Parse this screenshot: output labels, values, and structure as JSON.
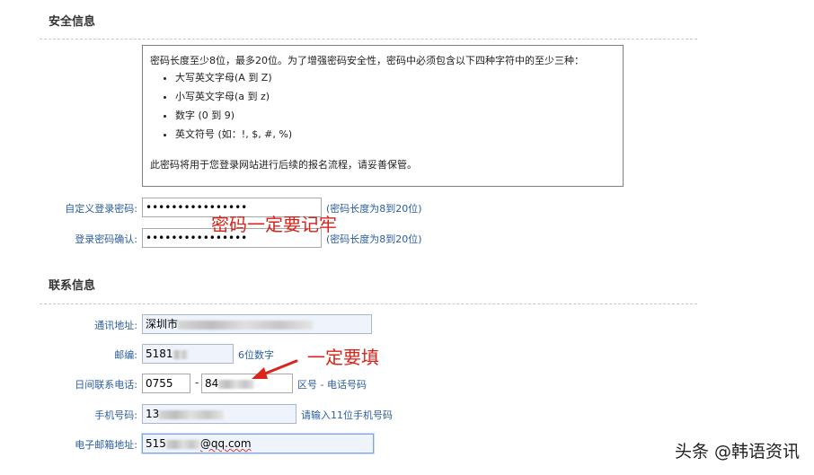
{
  "security": {
    "title": "安全信息",
    "rules_intro": "密码长度至少8位，最多20位。为了增强密码安全性，密码中必须包含以下四种字符中的至少三种：",
    "rules": [
      "大写英文字母(A 到 Z)",
      "小写英文字母(a 到 z)",
      "数字 (0 到 9)",
      "英文符号 (如：!, $, #, %)"
    ],
    "rules_note": "此密码将用于您登录网站进行后续的报名流程，请妥善保管。",
    "password_label": "自定义登录密码:",
    "password_value": "••••••••••••••••",
    "password_hint": "(密码长度为8到20位)",
    "confirm_label": "登录密码确认:",
    "confirm_value": "••••••••••••••••",
    "confirm_hint": "(密码长度为8到20位)",
    "annotation": "密码一定要记牢"
  },
  "contact": {
    "title": "联系信息",
    "address_label": "通讯地址:",
    "address_value": "深圳市",
    "postcode_label": "邮编:",
    "postcode_value": "5181",
    "postcode_hint": "6位数字",
    "phone_label": "日间联系电话:",
    "phone_area_value": "0755",
    "phone_sep": "-",
    "phone_number_value": "84",
    "phone_hint": "区号 - 电话号码",
    "mobile_label": "手机号码:",
    "mobile_value": "13",
    "mobile_hint": "请输入11位手机号码",
    "email_label": "电子邮箱地址:",
    "email_prefix": "515",
    "email_domain": "@qq.com",
    "annotation": "一定要填"
  },
  "watermark": "头条 @韩语资讯",
  "colors": {
    "label": "#2a5d9f",
    "annotation": "#d9231b"
  }
}
